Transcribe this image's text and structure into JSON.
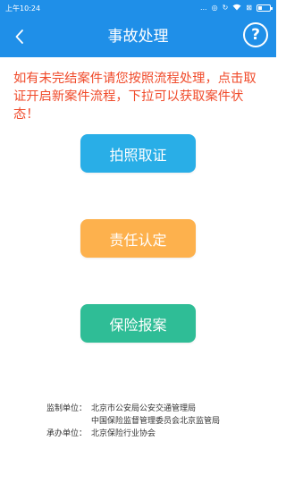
{
  "status_bar": {
    "time": "上午10:24",
    "dots": "...",
    "icons": [
      "alarm-icon",
      "sync-icon",
      "wifi-icon",
      "sim-icon",
      "battery-icon"
    ],
    "battery_level": 0.35
  },
  "header": {
    "back_icon": "chevron-left-icon",
    "title": "事故处理",
    "help_label": "?"
  },
  "notice": "如有未完结案件请您按照流程处理，点击取证开启新案件流程，下拉可以获取案件状态！",
  "buttons": {
    "photo_evidence": "拍照取证",
    "responsibility": "责任认定",
    "insurance_report": "保险报案"
  },
  "footer": {
    "supervisor_label": "监制单位：",
    "supervisor_1": "北京市公安局公安交通管理局",
    "supervisor_2": "中国保险监督管理委员会北京监管局",
    "organizer_label": "承办单位：",
    "organizer": "北京保险行业协会"
  },
  "colors": {
    "header": "#1f8fe8",
    "notice": "#f04a2a",
    "photo_button": "#29aee7",
    "responsibility_button": "#fdb14d",
    "report_button": "#2fbd96"
  }
}
